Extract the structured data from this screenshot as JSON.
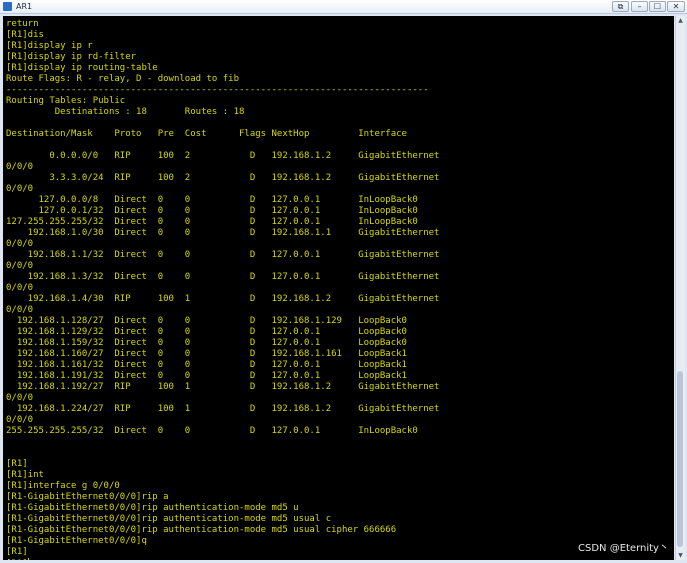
{
  "window": {
    "title": "AR1",
    "buttons": {
      "restore": "⧉",
      "minimize": "–",
      "maximize": "☐",
      "close": "✕"
    }
  },
  "terminal": {
    "text_color": "#d8d800",
    "background": "#000000",
    "lines": [
      "return",
      "[R1]dis",
      "[R1]display ip r",
      "[R1]display ip rd-filter",
      "[R1]display ip routing-table",
      "Route Flags: R - relay, D - download to fib",
      "------------------------------------------------------------------------------",
      "Routing Tables: Public",
      "         Destinations : 18       Routes : 18",
      "",
      "Destination/Mask    Proto   Pre  Cost      Flags NextHop         Interface",
      "",
      "        0.0.0.0/0   RIP     100  2           D   192.168.1.2     GigabitEthernet",
      "0/0/0",
      "        3.3.3.0/24  RIP     100  2           D   192.168.1.2     GigabitEthernet",
      "0/0/0",
      "      127.0.0.0/8   Direct  0    0           D   127.0.0.1       InLoopBack0",
      "      127.0.0.1/32  Direct  0    0           D   127.0.0.1       InLoopBack0",
      "127.255.255.255/32  Direct  0    0           D   127.0.0.1       InLoopBack0",
      "    192.168.1.0/30  Direct  0    0           D   192.168.1.1     GigabitEthernet",
      "0/0/0",
      "    192.168.1.1/32  Direct  0    0           D   127.0.0.1       GigabitEthernet",
      "0/0/0",
      "    192.168.1.3/32  Direct  0    0           D   127.0.0.1       GigabitEthernet",
      "0/0/0",
      "    192.168.1.4/30  RIP     100  1           D   192.168.1.2     GigabitEthernet",
      "0/0/0",
      "  192.168.1.128/27  Direct  0    0           D   192.168.1.129   LoopBack0",
      "  192.168.1.129/32  Direct  0    0           D   127.0.0.1       LoopBack0",
      "  192.168.1.159/32  Direct  0    0           D   127.0.0.1       LoopBack0",
      "  192.168.1.160/27  Direct  0    0           D   192.168.1.161   LoopBack1",
      "  192.168.1.161/32  Direct  0    0           D   127.0.0.1       LoopBack1",
      "  192.168.1.191/32  Direct  0    0           D   127.0.0.1       LoopBack1",
      "  192.168.1.192/27  RIP     100  1           D   192.168.1.2     GigabitEthernet",
      "0/0/0",
      "  192.168.1.224/27  RIP     100  1           D   192.168.1.2     GigabitEthernet",
      "0/0/0",
      "255.255.255.255/32  Direct  0    0           D   127.0.0.1       InLoopBack0",
      "",
      "",
      "[R1]",
      "[R1]int",
      "[R1]interface g 0/0/0",
      "[R1-GigabitEthernet0/0/0]rip a",
      "[R1-GigabitEthernet0/0/0]rip authentication-mode md5 u",
      "[R1-GigabitEthernet0/0/0]rip authentication-mode md5 usual c",
      "[R1-GigabitEthernet0/0/0]rip authentication-mode md5 usual cipher 666666",
      "[R1-GigabitEthernet0/0/0]q",
      "[R1]",
      "[R1]"
    ]
  },
  "watermark": "CSDN @Eternity丶"
}
